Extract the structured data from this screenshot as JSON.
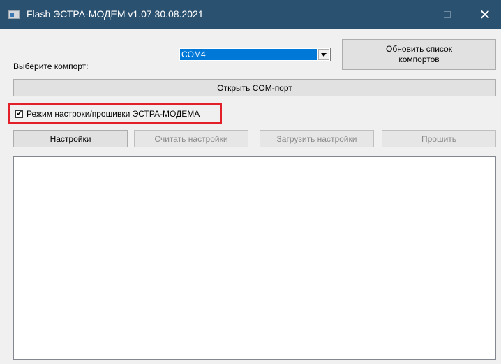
{
  "window": {
    "title": "Flash ЭСТРА-МОДЕМ v1.07 30.08.2021",
    "controls": [
      "minimize",
      "maximize",
      "close"
    ]
  },
  "port": {
    "label": "Выберите компорт:",
    "selected": "COM4"
  },
  "buttons": {
    "refresh_label": "Обновить список компортов",
    "open_label": "Открыть COM-порт",
    "settings_label": "Настройки",
    "read_label": "Считать настройки",
    "load_label": "Загрузить настройки",
    "flash_label": "Прошить"
  },
  "mode": {
    "label": "Режим настроки/прошивки ЭСТРА-МОДЕМА",
    "checked": true,
    "check_glyph": "✔"
  },
  "log": {
    "value": ""
  },
  "colors": {
    "titlebar": "#2b5171",
    "selection": "#0078d7",
    "highlight_box": "#e3202a"
  }
}
